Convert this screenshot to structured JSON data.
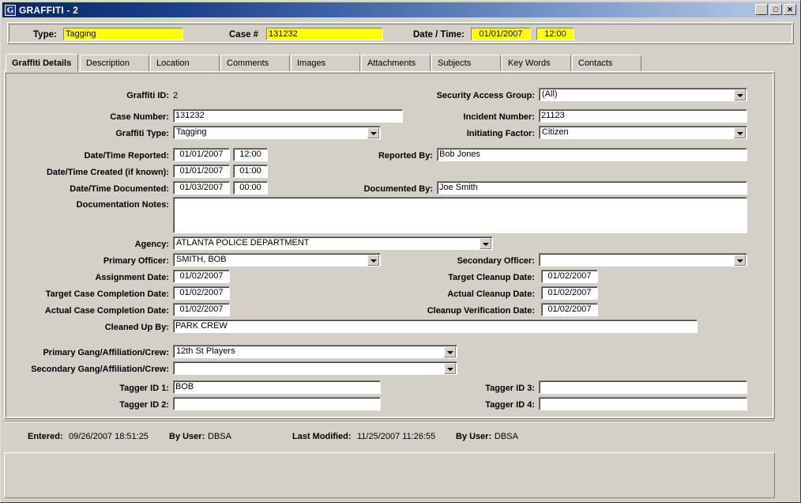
{
  "window": {
    "title": "GRAFFITI - 2",
    "icon": "graffiti-app-icon",
    "icon_glyph": "G",
    "buttons": {
      "minimize": "_",
      "maximize": "□",
      "close": "✕"
    },
    "titlebar_color": "#0a246a"
  },
  "header": {
    "type_label": "Type:",
    "type_value": "Tagging",
    "case_label": "Case #",
    "case_value": "131232",
    "datetime_label": "Date / Time:",
    "date_value": "01/01/2007",
    "time_value": "12:00",
    "highlight_color": "#ffff00"
  },
  "tabs": [
    {
      "label": "Graffiti Details",
      "active": true
    },
    {
      "label": "Description",
      "active": false
    },
    {
      "label": "Location",
      "active": false
    },
    {
      "label": "Comments",
      "active": false
    },
    {
      "label": "Images",
      "active": false
    },
    {
      "label": "Attachments",
      "active": false
    },
    {
      "label": "Subjects",
      "active": false
    },
    {
      "label": "Key Words",
      "active": false
    },
    {
      "label": "Contacts",
      "active": false
    }
  ],
  "form": {
    "graffiti_id_label": "Graffiti ID:",
    "graffiti_id_value": "2",
    "security_access_group_label": "Security Access Group:",
    "security_access_group_value": "(All)",
    "case_number_label": "Case Number:",
    "case_number_value": "131232",
    "incident_number_label": "Incident Number:",
    "incident_number_value": "21123",
    "graffiti_type_label": "Graffiti Type:",
    "graffiti_type_value": "Tagging",
    "initiating_factor_label": "Initiating Factor:",
    "initiating_factor_value": "Citizen",
    "datetime_reported_label": "Date/Time Reported:",
    "datetime_reported_date": "01/01/2007",
    "datetime_reported_time": "12:00",
    "reported_by_label": "Reported By:",
    "reported_by_value": "Bob Jones",
    "datetime_created_label": "Date/Time Created (if known):",
    "datetime_created_date": "01/01/2007",
    "datetime_created_time": "01:00",
    "datetime_documented_label": "Date/Time Documented:",
    "datetime_documented_date": "01/03/2007",
    "datetime_documented_time": "00:00",
    "documented_by_label": "Documented By:",
    "documented_by_value": "Joe Smith",
    "documentation_notes_label": "Documentation Notes:",
    "documentation_notes_value": "",
    "agency_label": "Agency:",
    "agency_value": "ATLANTA POLICE DEPARTMENT",
    "primary_officer_label": "Primary Officer:",
    "primary_officer_value": "SMITH,  BOB",
    "secondary_officer_label": "Secondary Officer:",
    "secondary_officer_value": "",
    "assignment_date_label": "Assignment Date:",
    "assignment_date_value": "01/02/2007",
    "target_cleanup_date_label": "Target Cleanup Date:",
    "target_cleanup_date_value": "01/02/2007",
    "target_case_completion_label": "Target Case Completion Date:",
    "target_case_completion_value": "01/02/2007",
    "actual_cleanup_date_label": "Actual Cleanup Date:",
    "actual_cleanup_date_value": "01/02/2007",
    "actual_case_completion_label": "Actual Case Completion Date:",
    "actual_case_completion_value": "01/02/2007",
    "cleanup_verification_label": "Cleanup Verification Date:",
    "cleanup_verification_value": "01/02/2007",
    "cleaned_up_by_label": "Cleaned Up By:",
    "cleaned_up_by_value": "PARK CREW",
    "primary_gang_label": "Primary Gang/Affiliation/Crew:",
    "primary_gang_value": "12th St Players",
    "secondary_gang_label": "Secondary Gang/Affiliation/Crew:",
    "secondary_gang_value": "",
    "tagger_id_1_label": "Tagger ID 1:",
    "tagger_id_1_value": "BOB",
    "tagger_id_2_label": "Tagger ID 2:",
    "tagger_id_2_value": "",
    "tagger_id_3_label": "Tagger ID 3:",
    "tagger_id_3_value": "",
    "tagger_id_4_label": "Tagger ID 4:",
    "tagger_id_4_value": ""
  },
  "footer": {
    "entered_label": "Entered:",
    "entered_value": "09/26/2007 18:51:25",
    "entered_by_label": "By User:",
    "entered_by_value": "DBSA",
    "modified_label": "Last Modified:",
    "modified_value": "11/25/2007 11:26:55",
    "modified_by_label": "By User:",
    "modified_by_value": "DBSA"
  }
}
